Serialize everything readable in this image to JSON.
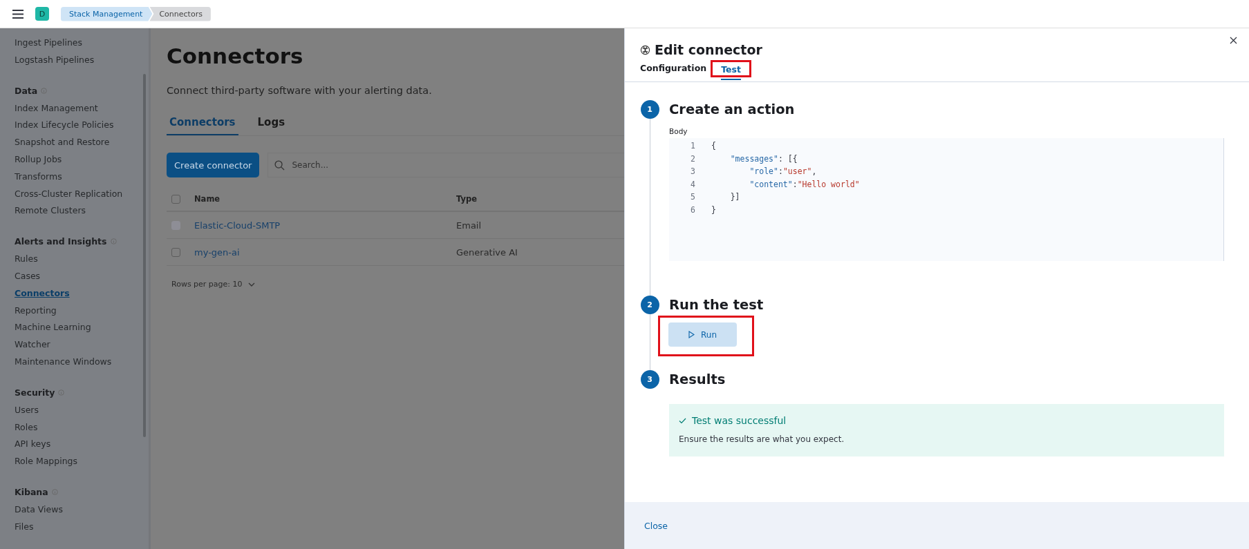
{
  "header": {
    "avatar": "D",
    "breadcrumbs": [
      {
        "label": "Stack Management",
        "selected": false
      },
      {
        "label": "Connectors",
        "selected": true
      }
    ]
  },
  "sidebar": {
    "items": [
      {
        "label": "Ingest Pipelines",
        "selected": false
      },
      {
        "label": "Logstash Pipelines",
        "selected": false
      }
    ],
    "sections": [
      {
        "title": "Data",
        "items": [
          {
            "label": "Index Management",
            "selected": false
          },
          {
            "label": "Index Lifecycle Policies",
            "selected": false
          },
          {
            "label": "Snapshot and Restore",
            "selected": false
          },
          {
            "label": "Rollup Jobs",
            "selected": false
          },
          {
            "label": "Transforms",
            "selected": false
          },
          {
            "label": "Cross-Cluster Replication",
            "selected": false
          },
          {
            "label": "Remote Clusters",
            "selected": false
          }
        ]
      },
      {
        "title": "Alerts and Insights",
        "items": [
          {
            "label": "Rules",
            "selected": false
          },
          {
            "label": "Cases",
            "selected": false
          },
          {
            "label": "Connectors",
            "selected": true
          },
          {
            "label": "Reporting",
            "selected": false
          },
          {
            "label": "Machine Learning",
            "selected": false
          },
          {
            "label": "Watcher",
            "selected": false
          },
          {
            "label": "Maintenance Windows",
            "selected": false
          }
        ]
      },
      {
        "title": "Security",
        "items": [
          {
            "label": "Users",
            "selected": false
          },
          {
            "label": "Roles",
            "selected": false
          },
          {
            "label": "API keys",
            "selected": false
          },
          {
            "label": "Role Mappings",
            "selected": false
          }
        ]
      },
      {
        "title": "Kibana",
        "items": [
          {
            "label": "Data Views",
            "selected": false
          },
          {
            "label": "Files",
            "selected": false
          }
        ]
      }
    ]
  },
  "page": {
    "title": "Connectors",
    "description": "Connect third-party software with your alerting data.",
    "tabs": [
      {
        "label": "Connectors",
        "selected": true
      },
      {
        "label": "Logs",
        "selected": false
      }
    ],
    "create_button": "Create connector",
    "search": {
      "placeholder": "Search..."
    },
    "table": {
      "select_all_checked": false,
      "columns": [
        "Name",
        "Type"
      ],
      "rows": [
        {
          "name": "Elastic-Cloud-SMTP",
          "type": "Email",
          "disabled": true
        },
        {
          "name": "my-gen-ai",
          "type": "Generative AI",
          "disabled": false,
          "checked": false
        }
      ]
    },
    "rows_per_page": "Rows per page: 10"
  },
  "flyout": {
    "title": "Edit connector",
    "tabs": [
      {
        "label": "Configuration",
        "selected": false,
        "highlighted": false
      },
      {
        "label": "Test",
        "selected": true,
        "highlighted": true
      }
    ],
    "steps": [
      {
        "number": "1",
        "title": "Create an action",
        "kind": "editor",
        "field_label": "Body",
        "code": [
          {
            "number": "1",
            "tokens": [
              {
                "text": "{",
                "kind": "punct"
              }
            ]
          },
          {
            "number": "2",
            "tokens": [
              {
                "text": "    \"messages\"",
                "kind": "key"
              },
              {
                "text": ": [{",
                "kind": "punct"
              }
            ]
          },
          {
            "number": "3",
            "tokens": [
              {
                "text": "        \"role\"",
                "kind": "key"
              },
              {
                "text": ":",
                "kind": "punct"
              },
              {
                "text": "\"user\"",
                "kind": "string"
              },
              {
                "text": ",",
                "kind": "punct"
              }
            ]
          },
          {
            "number": "4",
            "tokens": [
              {
                "text": "        \"content\"",
                "kind": "key"
              },
              {
                "text": ":",
                "kind": "punct"
              },
              {
                "text": "\"Hello world\"",
                "kind": "string"
              }
            ]
          },
          {
            "number": "5",
            "tokens": [
              {
                "text": "    }]",
                "kind": "punct"
              }
            ]
          },
          {
            "number": "6",
            "tokens": [
              {
                "text": "}",
                "kind": "punct"
              }
            ]
          }
        ]
      },
      {
        "number": "2",
        "title": "Run the test",
        "kind": "button",
        "button": "Run",
        "highlighted": true
      },
      {
        "number": "3",
        "title": "Results",
        "kind": "callout",
        "callout_title": "Test was successful",
        "callout_text": "Ensure the results are what you expect."
      }
    ]
  },
  "footer": {
    "close": "Close"
  }
}
